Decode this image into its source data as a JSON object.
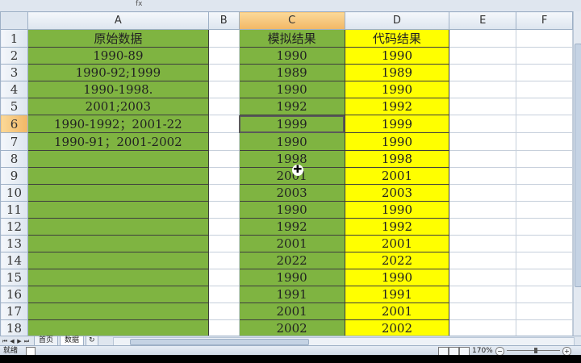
{
  "toolbar_fragment": "fx",
  "columns": [
    "A",
    "B",
    "C",
    "D",
    "E",
    "F"
  ],
  "selected_column": "C",
  "selected_row": "6",
  "rows": [
    {
      "n": "1",
      "a": "原始数据",
      "c": "模拟结果",
      "d": "代码结果"
    },
    {
      "n": "2",
      "a": "1990-89",
      "c": "1990",
      "d": "1990"
    },
    {
      "n": "3",
      "a": "1990-92;1999",
      "c": "1989",
      "d": "1989"
    },
    {
      "n": "4",
      "a": "1990-1998.",
      "c": "1990",
      "d": "1990"
    },
    {
      "n": "5",
      "a": "2001;2003",
      "c": "1992",
      "d": "1992"
    },
    {
      "n": "6",
      "a": "1990-1992；2001-22",
      "c": "1999",
      "d": "1999"
    },
    {
      "n": "7",
      "a": "1990-91；2001-2002",
      "c": "1990",
      "d": "1990"
    },
    {
      "n": "8",
      "a": "",
      "c": "1998",
      "d": "1998"
    },
    {
      "n": "9",
      "a": "",
      "c": "2001",
      "d": "2001"
    },
    {
      "n": "10",
      "a": "",
      "c": "2003",
      "d": "2003"
    },
    {
      "n": "11",
      "a": "",
      "c": "1990",
      "d": "1990"
    },
    {
      "n": "12",
      "a": "",
      "c": "1992",
      "d": "1992"
    },
    {
      "n": "13",
      "a": "",
      "c": "2001",
      "d": "2001"
    },
    {
      "n": "14",
      "a": "",
      "c": "2022",
      "d": "2022"
    },
    {
      "n": "15",
      "a": "",
      "c": "1990",
      "d": "1990"
    },
    {
      "n": "16",
      "a": "",
      "c": "1991",
      "d": "1991"
    },
    {
      "n": "17",
      "a": "",
      "c": "2001",
      "d": "2001"
    },
    {
      "n": "18",
      "a": "",
      "c": "2002",
      "d": "2002"
    }
  ],
  "sheet_tabs": [
    "首页",
    "数据"
  ],
  "active_tab": "数据",
  "status": {
    "mode": "就绪",
    "zoom": "170%"
  },
  "colors": {
    "green": "#7fb441",
    "yellow": "#ffff00",
    "header_selected": "#f2b765"
  }
}
